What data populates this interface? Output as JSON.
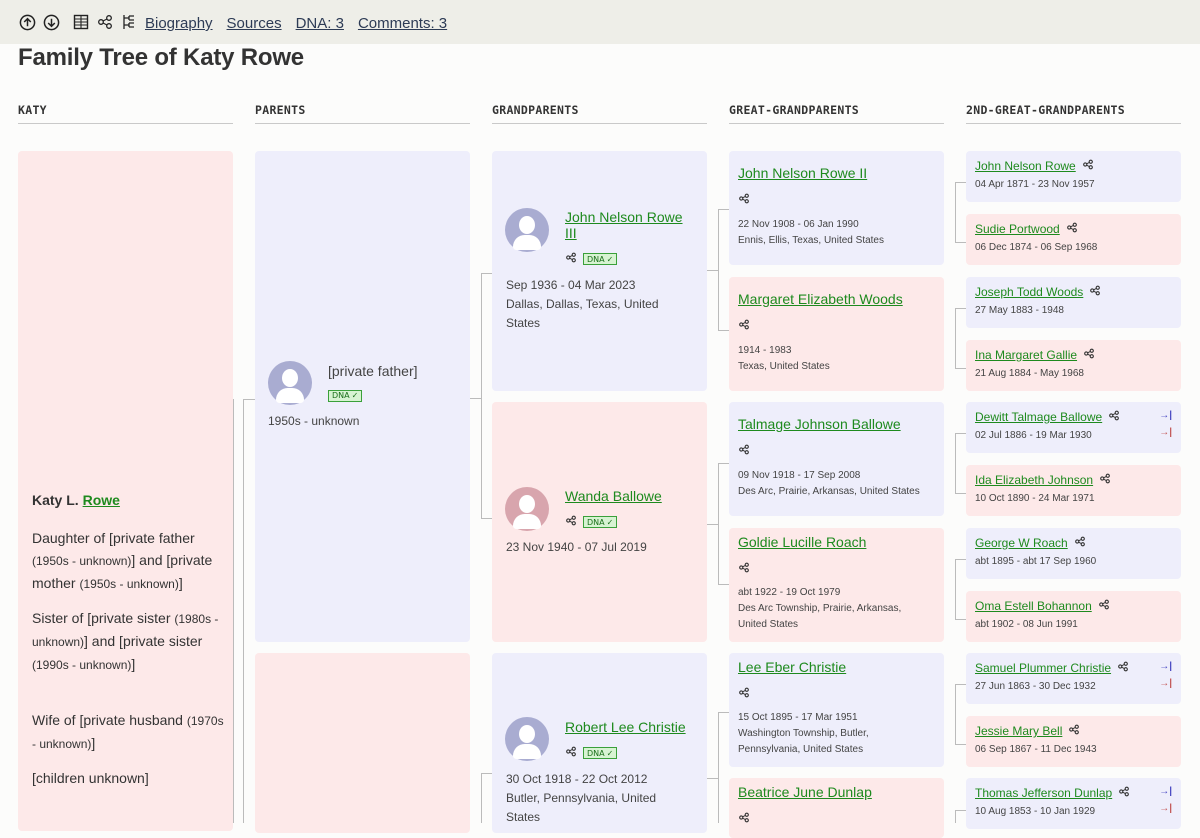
{
  "topbar": {
    "icons": [
      "arrow-up-circle-icon",
      "arrow-down-circle-icon",
      "grid-icon",
      "tree-icon",
      "pedigree-icon"
    ],
    "links": [
      "Biography",
      "Sources",
      "DNA: 3",
      "Comments: 3"
    ]
  },
  "title": "Family Tree of Katy Rowe",
  "columns": [
    "KATY",
    "PARENTS",
    "GRANDPARENTS",
    "GREAT-GRANDPARENTS",
    "2ND-GREAT-GRANDPARENTS"
  ],
  "dna_label": "DNA",
  "katy": {
    "first": "Katy L.",
    "last": "Rowe",
    "p1": "Daughter of [private father ",
    "p1s": "(1950s - unknown)",
    "p1b": "] and [private mother ",
    "p1bs": "(1950s - unknown)",
    "p1c": "]",
    "p2": "Sister of [private sister ",
    "p2s": "(1980s - unknown)",
    "p2b": "] and [private sister ",
    "p2bs": "(1990s - unknown)",
    "p2c": "]",
    "p3": "Wife of [private husband ",
    "p3s": "(1970s - unknown)",
    "p3c": "]",
    "p4": "[children unknown]"
  },
  "parents": [
    {
      "name": "[private father]",
      "dates": "1950s - unknown"
    }
  ],
  "grandparents": [
    {
      "name": "John Nelson Rowe III",
      "dates": "Sep 1936 - 04 Mar 2023",
      "place": "Dallas, Dallas, Texas, United States"
    },
    {
      "name": "Wanda Ballowe",
      "dates": "23 Nov 1940 - 07 Jul 2019",
      "place": ""
    },
    {
      "name": "Robert Lee Christie",
      "dates": "30 Oct 1918 - 22 Oct 2012",
      "place": "Butler, Pennsylvania, United States"
    }
  ],
  "great_grandparents": [
    {
      "name": "John Nelson Rowe II",
      "dates": "22 Nov 1908 - 06 Jan 1990",
      "place": "Ennis, Ellis, Texas, United States"
    },
    {
      "name": "Margaret Elizabeth Woods",
      "dates": "1914 - 1983",
      "place": "Texas, United States"
    },
    {
      "name": "Talmage Johnson Ballowe",
      "dates": "09 Nov 1918 - 17 Sep 2008",
      "place": "Des Arc, Prairie, Arkansas, United States"
    },
    {
      "name": "Goldie Lucille Roach",
      "dates": "abt 1922 - 19 Oct 1979",
      "place": "Des Arc Township, Prairie, Arkansas, United States"
    },
    {
      "name": "Lee Eber Christie",
      "dates": "15 Oct 1895 - 17 Mar 1951",
      "place": "Washington Township, Butler, Pennsylvania, United States"
    },
    {
      "name": "Beatrice June Dunlap",
      "dates": "",
      "place": ""
    }
  ],
  "second_great_grandparents": [
    {
      "name": "John Nelson Rowe",
      "dates": "04 Apr 1871 - 23 Nov 1957"
    },
    {
      "name": "Sudie Portwood",
      "dates": "06 Dec 1874 - 06 Sep 1968"
    },
    {
      "name": "Joseph Todd Woods",
      "dates": "27 May 1883 - 1948"
    },
    {
      "name": "Ina Margaret Gallie",
      "dates": "21 Aug 1884 - May 1968"
    },
    {
      "name": "Dewitt Talmage Ballowe",
      "dates": "02 Jul 1886 - 19 Mar 1930"
    },
    {
      "name": "Ida Elizabeth Johnson",
      "dates": "10 Oct 1890 - 24 Mar 1971"
    },
    {
      "name": "George W Roach",
      "dates": "abt 1895 - abt 17 Sep 1960"
    },
    {
      "name": "Oma Estell Bohannon",
      "dates": "abt 1902 - 08 Jun 1991"
    },
    {
      "name": "Samuel Plummer Christie",
      "dates": "27 Jun 1863 - 30 Dec 1932"
    },
    {
      "name": "Jessie Mary Bell",
      "dates": "06 Sep 1867 - 11 Dec 1943"
    },
    {
      "name": "Thomas Jefferson Dunlap",
      "dates": "10 Aug 1853 - 10 Jan 1929"
    }
  ],
  "arrow_glyph": "→|",
  "colors": {
    "male_bg": "#eeeefb",
    "female_bg": "#fde9e9",
    "link": "#1e8a1e",
    "topbar": "#eeeee8"
  }
}
